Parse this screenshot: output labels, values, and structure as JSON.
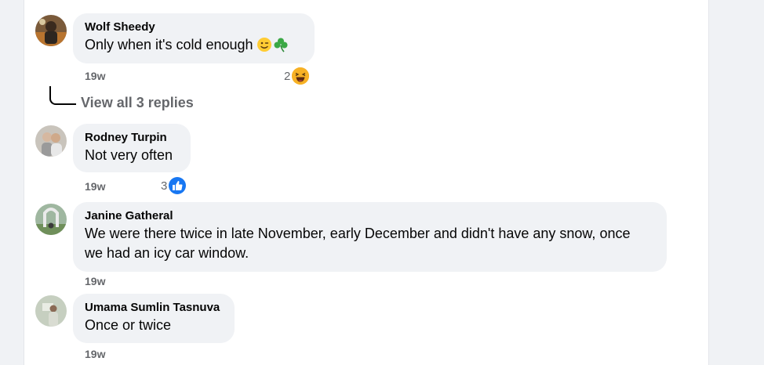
{
  "comments": [
    {
      "author": "Wolf Sheedy",
      "text": "Only when it's cold enough",
      "emojis": [
        "winking-face-emoji",
        "shamrock-emoji"
      ],
      "time": "19w",
      "reaction_count": "2",
      "reaction_icon": "laughing-face-icon",
      "replies_label": "View all 3 replies"
    },
    {
      "author": "Rodney Turpin",
      "text": "Not very often",
      "time": "19w",
      "reaction_count": "3",
      "reaction_icon": "thumbs-up-icon"
    },
    {
      "author": "Janine Gatheral",
      "text_line1": "We were there twice in late November, early December and didn't have any snow, once",
      "text_line2": "we had an icy car window.",
      "time": "19w"
    },
    {
      "author": "Umama Sumlin Tasnuva",
      "text": "Once or twice",
      "time": "19w"
    }
  ],
  "colors": {
    "page_background": "#f0f2f5",
    "panel_background": "#ffffff",
    "bubble_background": "#f0f2f5",
    "secondary_text": "#65676b",
    "like_blue": "#1877f2",
    "haha_yellow": "#f7b125"
  }
}
